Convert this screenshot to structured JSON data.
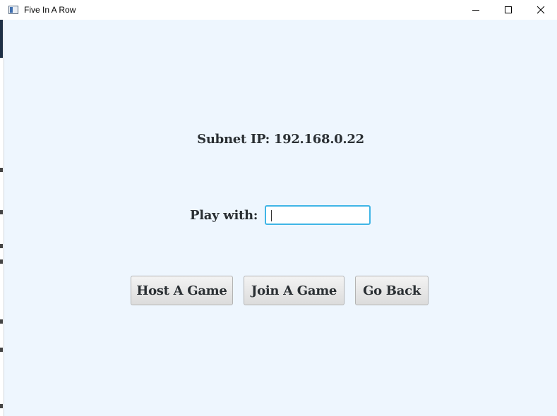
{
  "window": {
    "title": "Five In A Row",
    "controls": {
      "minimize_icon": "minimize-icon",
      "maximize_icon": "maximize-icon",
      "close_icon": "close-icon"
    }
  },
  "main": {
    "subnet_text": "Subnet IP: 192.168.0.22",
    "play_with_label": "Play with:",
    "play_with_value": "",
    "play_with_placeholder": ""
  },
  "buttons": {
    "host": "Host A Game",
    "join": "Join A Game",
    "back": "Go Back"
  },
  "colors": {
    "background": "#eef6fe",
    "focus_border": "#3fb5e6",
    "text": "#2a2f33"
  }
}
